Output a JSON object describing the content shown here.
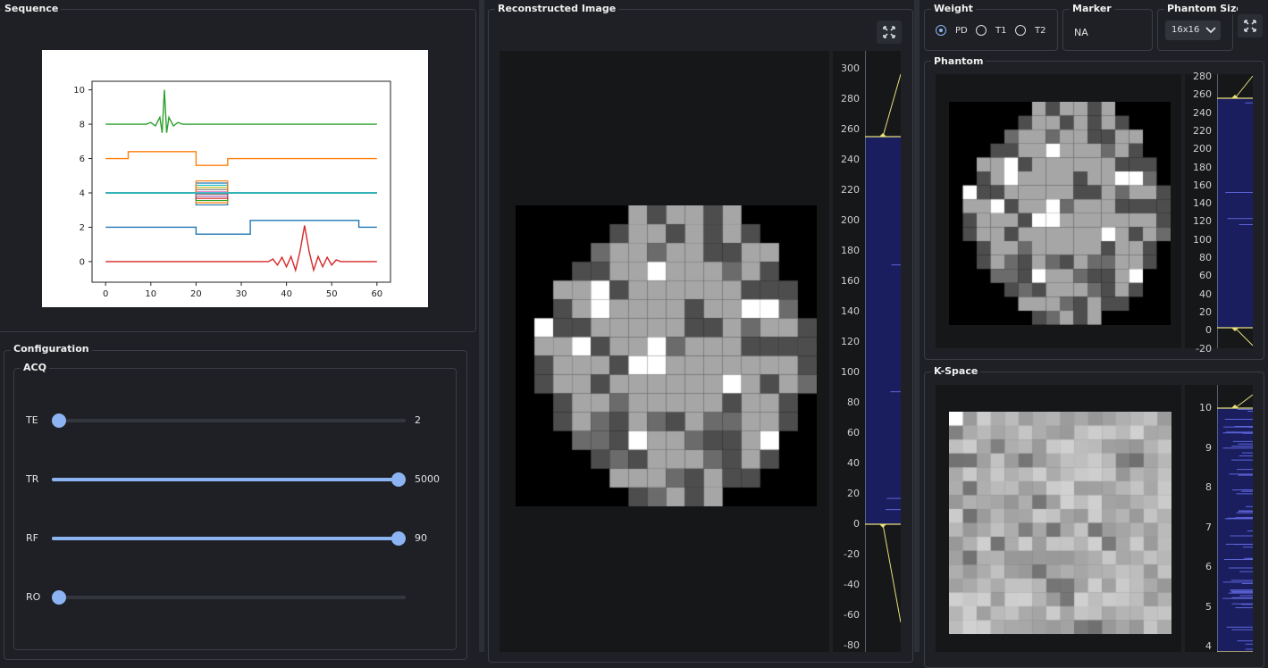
{
  "sequence": {
    "title": "Sequence",
    "chart_data": {
      "type": "line",
      "title": "",
      "xlabel": "",
      "ylabel": "",
      "xlim": [
        -3,
        63
      ],
      "ylim": [
        -1.2,
        10.5
      ],
      "xticks": [
        "0",
        "10",
        "20",
        "30",
        "40",
        "50",
        "60"
      ],
      "yticks": [
        "0",
        "2",
        "4",
        "6",
        "8",
        "10"
      ],
      "series": [
        {
          "color": "#2ca02c",
          "points": [
            [
              0,
              8
            ],
            [
              9,
              8
            ],
            [
              10,
              8.1
            ],
            [
              11,
              7.9
            ],
            [
              12,
              8.4
            ],
            [
              12.5,
              7.5
            ],
            [
              13,
              10
            ],
            [
              13.5,
              7.5
            ],
            [
              14,
              8.4
            ],
            [
              15,
              7.9
            ],
            [
              16,
              8.1
            ],
            [
              17,
              8
            ],
            [
              60,
              8
            ]
          ]
        },
        {
          "color": "#ff7f0e",
          "points": [
            [
              0,
              6
            ],
            [
              5,
              6
            ],
            [
              5,
              6.4
            ],
            [
              20,
              6.4
            ],
            [
              20,
              5.6
            ],
            [
              27,
              5.6
            ],
            [
              27,
              6
            ],
            [
              60,
              6
            ]
          ]
        },
        {
          "color": "#1f77b4",
          "points": [
            [
              0,
              2
            ],
            [
              20,
              2
            ],
            [
              20,
              1.6
            ],
            [
              32,
              1.6
            ],
            [
              32,
              2.4
            ],
            [
              56,
              2.4
            ],
            [
              56,
              2
            ],
            [
              60,
              2
            ]
          ]
        },
        {
          "color": "#d62728",
          "points": [
            [
              0,
              0
            ],
            [
              36,
              0
            ],
            [
              37,
              0.15
            ],
            [
              38,
              -0.2
            ],
            [
              39,
              0.25
            ],
            [
              40,
              -0.3
            ],
            [
              41,
              0.3
            ],
            [
              42,
              -0.5
            ],
            [
              43,
              0.6
            ],
            [
              44,
              2.1
            ],
            [
              45,
              0.6
            ],
            [
              46,
              -0.5
            ],
            [
              47,
              0.3
            ],
            [
              48,
              -0.3
            ],
            [
              49,
              0.25
            ],
            [
              50,
              -0.2
            ],
            [
              51,
              0.1
            ],
            [
              52,
              0
            ],
            [
              60,
              0
            ]
          ]
        },
        {
          "color": "#17becf",
          "points": [
            [
              0,
              4
            ],
            [
              60,
              4
            ]
          ]
        }
      ],
      "gradient_box": {
        "x": [
          20,
          27
        ],
        "y": [
          3.3,
          4.7
        ]
      }
    }
  },
  "configuration": {
    "title": "Configuration",
    "acq_title": "ACQ",
    "sliders": [
      {
        "label": "TE",
        "value": "2",
        "fraction": 0.0
      },
      {
        "label": "TR",
        "value": "5000",
        "fraction": 1.0
      },
      {
        "label": "RF",
        "value": "90",
        "fraction": 1.0
      },
      {
        "label": "RO",
        "value": "",
        "fraction": 0.0
      }
    ]
  },
  "reconstructed": {
    "title": "Reconstructed Image",
    "axis_ticks": [
      "300",
      "280",
      "260",
      "240",
      "220",
      "200",
      "180",
      "160",
      "140",
      "120",
      "100",
      "80",
      "60",
      "40",
      "20",
      "0",
      "-20",
      "-40",
      "-60",
      "-80"
    ]
  },
  "weight": {
    "title": "Weight",
    "options": [
      "PD",
      "T1",
      "T2"
    ],
    "selected": "PD"
  },
  "marker": {
    "title": "Marker",
    "value": "NA"
  },
  "phantom_size": {
    "title": "Phantom Size",
    "value": "16x16",
    "options": [
      "16x16"
    ]
  },
  "phantom": {
    "title": "Phantom",
    "axis_ticks": [
      "280",
      "260",
      "240",
      "220",
      "200",
      "180",
      "160",
      "140",
      "120",
      "100",
      "80",
      "60",
      "40",
      "20",
      "0",
      "-20"
    ]
  },
  "kspace": {
    "title": "K-Space",
    "axis_ticks": [
      "10",
      "9",
      "8",
      "7",
      "6",
      "5",
      "4"
    ]
  },
  "brain_grid": [
    "0000001111110000",
    "0000011111111000",
    "0000111111111100",
    "0001111111111100",
    "0011111111111110",
    "0011111111111110",
    "0111111111111111",
    "0111111111111111",
    "0111111111111111",
    "0111111111111111",
    "0011111111111110",
    "0011111111111110",
    "0001111111111100",
    "0000111111111100",
    "0000011111111000",
    "0000001111100000"
  ],
  "colors": {
    "bg": "#1e2025",
    "accent": "#8db4f2",
    "histogram_bg": "#1a1e5e",
    "histogram_line": "#e8e07a"
  }
}
